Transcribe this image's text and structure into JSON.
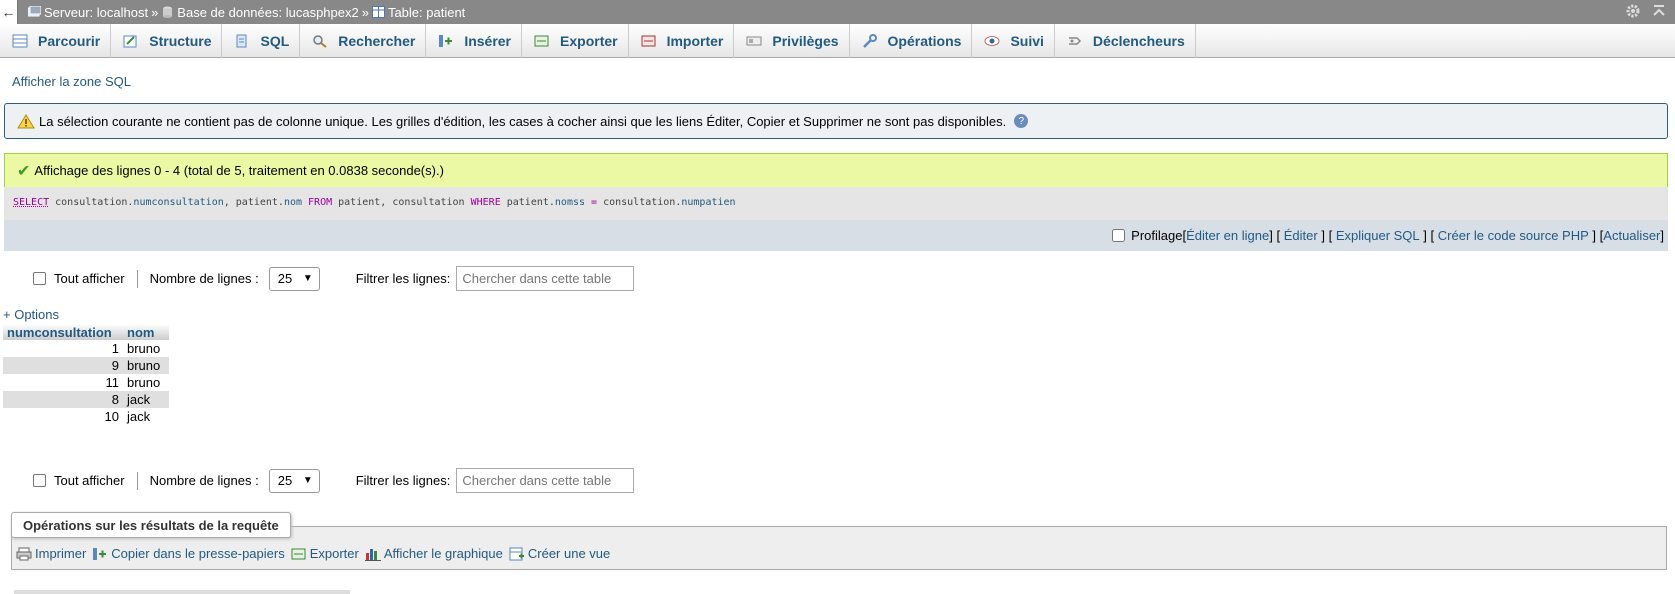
{
  "topbar": {
    "back": "←",
    "server": "Serveur: localhost",
    "database": "Base de données: lucasphpex2",
    "table": "Table: patient",
    "sep": "»"
  },
  "tabs": [
    {
      "label": "Parcourir",
      "icon": "browse-icon"
    },
    {
      "label": "Structure",
      "icon": "structure-icon"
    },
    {
      "label": "SQL",
      "icon": "sql-icon"
    },
    {
      "label": "Rechercher",
      "icon": "search-icon"
    },
    {
      "label": "Insérer",
      "icon": "insert-icon"
    },
    {
      "label": "Exporter",
      "icon": "export-icon"
    },
    {
      "label": "Importer",
      "icon": "import-icon"
    },
    {
      "label": "Privilèges",
      "icon": "privileges-icon"
    },
    {
      "label": "Opérations",
      "icon": "operations-icon"
    },
    {
      "label": "Suivi",
      "icon": "tracking-icon"
    },
    {
      "label": "Déclencheurs",
      "icon": "triggers-icon"
    }
  ],
  "sql_zone_link": "Afficher la zone SQL",
  "warning": "La sélection courante ne contient pas de colonne unique. Les grilles d'édition, les cases à cocher ainsi que les liens Éditer, Copier et Supprimer ne sont pas disponibles.",
  "success": "Affichage des lignes 0 - 4 (total de 5, traitement en 0.0838 seconde(s).)",
  "sql": {
    "select": "SELECT",
    "t1": " consultation.",
    "c1": "numconsultation",
    "t2": ", patient.",
    "c2": "nom",
    "from": " FROM",
    "t3": " patient, consultation ",
    "where": "WHERE",
    "t4": " patient.",
    "c3": "nomss",
    "eq": " = ",
    "t5": "consultation.",
    "c4": "numpatien"
  },
  "profiling": {
    "label": "Profilage",
    "lb": "[",
    "rb": "]",
    "links": [
      "Éditer en ligne",
      "Éditer",
      "Expliquer SQL",
      "Créer le code source PHP",
      "Actualiser"
    ]
  },
  "nav": {
    "show_all": "Tout afficher",
    "rows_label": "Nombre de lignes :",
    "rows_value": "25",
    "filter_label": "Filtrer les lignes:",
    "filter_placeholder": "Chercher dans cette table"
  },
  "options_link": "+ Options",
  "table": {
    "headers": [
      "numconsultation",
      "nom"
    ],
    "rows": [
      [
        "1",
        "bruno"
      ],
      [
        "9",
        "bruno"
      ],
      [
        "11",
        "bruno"
      ],
      [
        "8",
        "jack"
      ],
      [
        "10",
        "jack"
      ]
    ]
  },
  "operations": {
    "legend": "Opérations sur les résultats de la requête",
    "actions": [
      {
        "label": "Imprimer",
        "icon": "print-icon"
      },
      {
        "label": "Copier dans le presse-papiers",
        "icon": "copy-icon"
      },
      {
        "label": "Exporter",
        "icon": "export-icon"
      },
      {
        "label": "Afficher le graphique",
        "icon": "chart-icon"
      },
      {
        "label": "Créer une vue",
        "icon": "view-icon"
      }
    ]
  },
  "colors": {
    "link": "#235a81",
    "success_bg": "#ebf8a4",
    "warning_border": "#2f5d7e"
  }
}
